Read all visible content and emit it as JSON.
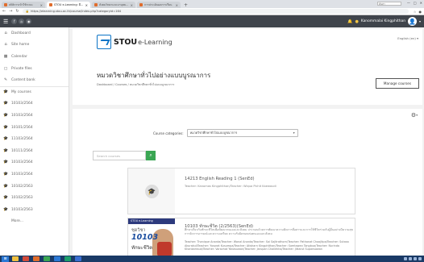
{
  "browser": {
    "tabs": [
      {
        "title": "สถิติการเข้าใช้ระบบ",
        "active": false
      },
      {
        "title": "STOU e-Learning: มีระบบ",
        "active": true
      },
      {
        "title": "สังคมวิทยาและมานุษยวิทยา",
        "active": false
      },
      {
        "title": "การประเมินผลการเรียน",
        "active": false
      }
    ],
    "new_tab": "+",
    "window_search": "ค้นหา",
    "url": "https://elearning.stou.ac.th/course/index.php?categoryid=164",
    "min": "—",
    "max": "□",
    "close": "✕"
  },
  "navbar": {
    "user_name": "Kanommalai Kingphithan"
  },
  "sidebar": {
    "items": [
      {
        "label": "Dashboard",
        "icon": "⌂"
      },
      {
        "label": "Site home",
        "icon": "⌂"
      },
      {
        "label": "Calendar",
        "icon": "▦"
      },
      {
        "label": "Private files",
        "icon": "▢"
      },
      {
        "label": "Content bank",
        "icon": "✎"
      },
      {
        "label": "My courses",
        "icon": "🎓"
      },
      {
        "label": "10103/2564",
        "icon": "🎓"
      },
      {
        "label": "10103/2564",
        "icon": "🎓"
      },
      {
        "label": "10101/2564",
        "icon": "🎓"
      },
      {
        "label": "11103/2564",
        "icon": "🎓"
      },
      {
        "label": "10111/2564",
        "icon": "🎓"
      },
      {
        "label": "10103/2564",
        "icon": "🎓"
      },
      {
        "label": "10103/2564",
        "icon": "🎓"
      },
      {
        "label": "10102/2563",
        "icon": "🎓"
      },
      {
        "label": "10102/2563",
        "icon": "🎓"
      },
      {
        "label": "10103/2563",
        "icon": "🎓"
      },
      {
        "label": "More...",
        "icon": ""
      }
    ]
  },
  "header": {
    "logo_text": "STOU",
    "logo_sub": "e-Learning",
    "language": "English (en) ▾",
    "course_title": "หมวดวิชาศึกษาทั่วไปอย่างแบบบูรณาการ",
    "breadcrumb": "Dashboard / Courses / หมวดวิชาศึกษาทั่วไปแบบบูรณาการ",
    "manage_button": "Manage courses"
  },
  "main": {
    "gear": "⚙",
    "gear_caret": "▾",
    "category_label": "Course categories:",
    "category_value": "หมวดวิชาศึกษาทั่วไปแบบบูรณาการ",
    "search_placeholder": "Search courses",
    "courses": [
      {
        "title": "14213 English Reading 1 (SenEd)",
        "description": "Teacher: Kanomas Kingphithan/Teacher: Wiqua Pichit Kaewaudi"
      },
      {
        "title": "10103 ทักษะชีวิต (2/2563)(SenEd)",
        "description": "ศึกษาเกี่ยวกับทักษะชีวิตเพื่อพัฒนาตนเองและสังคม ประกอบด้วยการพัฒนาความคิดการสื่อสารและการใช้ชีวิตร่วมกับผู้อื่นอย่างมีความสุข การจัดการอารมณ์และความเครียด ความรับผิดชอบต่อตนเองและสังคม",
        "teachers": "Teacher: Thanique Ananta/Teacher: Wanal Ananta/Teacher: Sai Sajitrathorn/Teacher: Pathanat Choojitpa/Teacher: Sutasa Akurakul/Teacher: Yusorat Kusumpa/Teacher: Atisharn Kingphithan/Teacher: Somtawan Tongbua/Teacher: Nurinda Khankamsuk/Teacher: Vorachat Yanasuwan/Teacher: Jarupan Chailekha/Teacher: Jittarut Supansawan",
        "thumb_stripe": "STOU e-Learning",
        "thumb_label": "ชุดวิชา",
        "thumb_code": "10103",
        "thumb_name": "ทักษะชีวิต"
      }
    ]
  },
  "colors": {
    "navbar": "#3f444b",
    "brand_blue": "#0c74c6",
    "search_green": "#3aa653",
    "taskbar": "#1a3a66"
  }
}
